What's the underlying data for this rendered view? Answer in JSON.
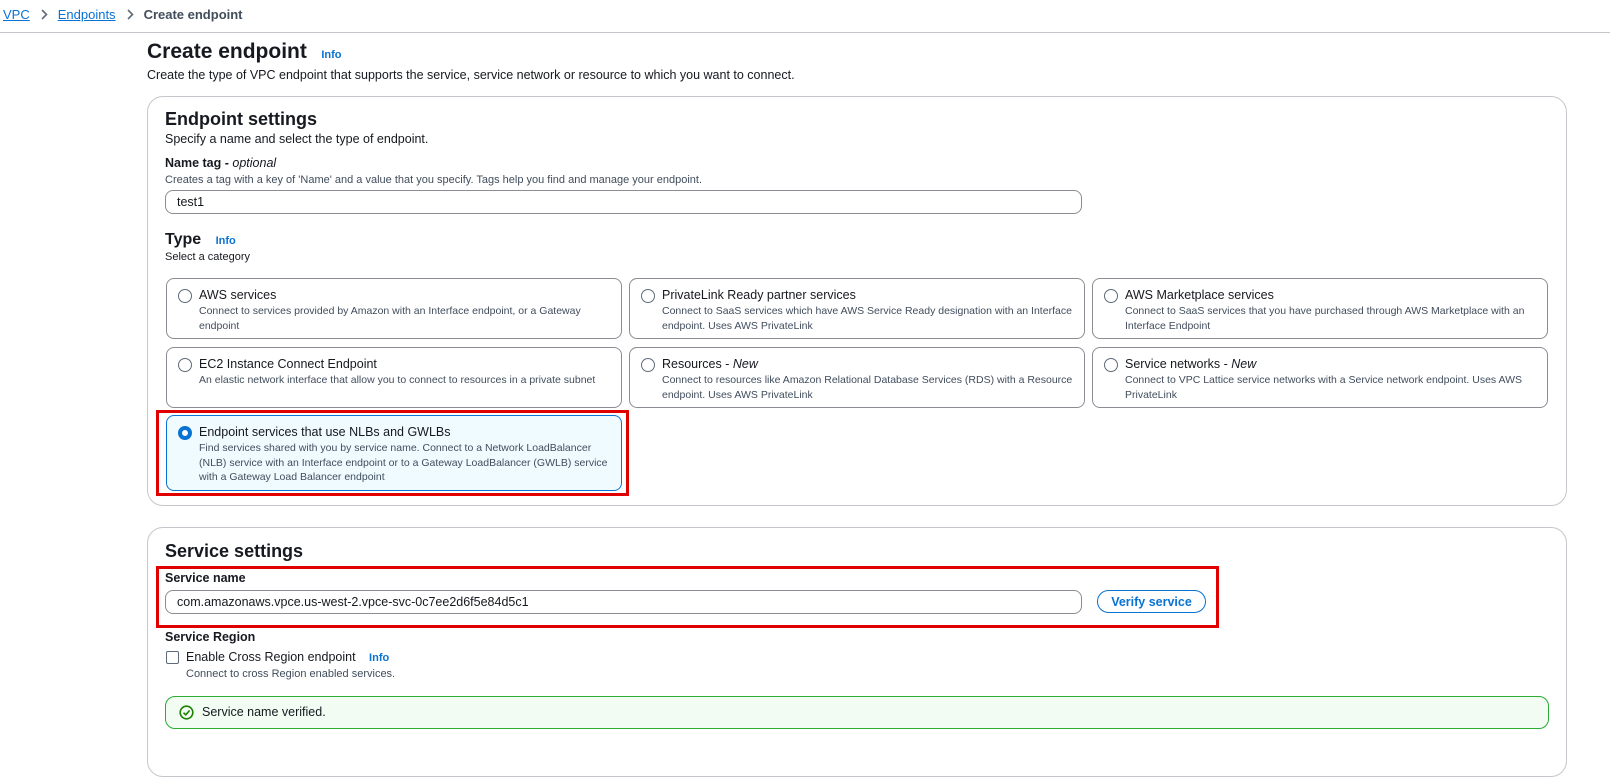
{
  "breadcrumb": {
    "root": "VPC",
    "parent": "Endpoints",
    "current": "Create endpoint"
  },
  "page": {
    "title": "Create endpoint",
    "info": "Info",
    "description": "Create the type of VPC endpoint that supports the service, service network or resource to which you want to connect."
  },
  "endpoint_settings": {
    "title": "Endpoint settings",
    "description": "Specify a name and select the type of endpoint.",
    "name_tag": {
      "label": "Name tag - ",
      "optional": "optional",
      "hint": "Creates a tag with a key of 'Name' and a value that you specify. Tags help you find and manage your endpoint.",
      "value": "test1"
    },
    "type": {
      "title": "Type",
      "info": "Info",
      "description": "Select a category",
      "selected_index": 6,
      "options": [
        {
          "title": "AWS services",
          "new": "",
          "desc": "Connect to services provided by Amazon with an Interface endpoint, or a Gateway endpoint"
        },
        {
          "title": "PrivateLink Ready partner services",
          "new": "",
          "desc": "Connect to SaaS services which have AWS Service Ready designation with an Interface endpoint. Uses AWS PrivateLink"
        },
        {
          "title": "AWS Marketplace services",
          "new": "",
          "desc": "Connect to SaaS services that you have purchased through AWS Marketplace with an Interface Endpoint"
        },
        {
          "title": "EC2 Instance Connect Endpoint",
          "new": "",
          "desc": "An elastic network interface that allow you to connect to resources in a private subnet"
        },
        {
          "title": "Resources - ",
          "new": "New",
          "desc": "Connect to resources like Amazon Relational Database Services (RDS) with a Resource endpoint. Uses AWS PrivateLink"
        },
        {
          "title": "Service networks - ",
          "new": "New",
          "desc": "Connect to VPC Lattice service networks with a Service network endpoint. Uses AWS PrivateLink"
        },
        {
          "title": "Endpoint services that use NLBs and GWLBs",
          "new": "",
          "desc": "Find services shared with you by service name. Connect to a Network LoadBalancer (NLB) service with an Interface endpoint or to a Gateway LoadBalancer (GWLB) service with a Gateway Load Balancer endpoint"
        }
      ]
    }
  },
  "service_settings": {
    "title": "Service settings",
    "service_name": {
      "label": "Service name",
      "value": "com.amazonaws.vpce.us-west-2.vpce-svc-0c7ee2d6f5e84d5c1",
      "verify_label": "Verify service"
    },
    "service_region": {
      "label": "Service Region",
      "checkbox_label": "Enable Cross Region endpoint",
      "checked": false,
      "info": "Info",
      "hint": "Connect to cross Region enabled services."
    },
    "status": {
      "message": "Service name verified.",
      "color": "#29ad32",
      "icon": "check-circle-icon"
    }
  },
  "colors": {
    "accent": "#0972d3",
    "highlight": "#e00000",
    "success": "#29ad32"
  }
}
